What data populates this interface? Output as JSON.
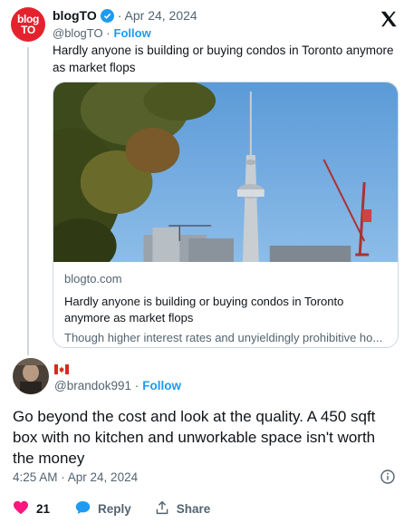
{
  "quoted": {
    "avatar_line1": "blog",
    "avatar_line2": "TO",
    "name": "blogTO",
    "date": "· Apr 24, 2024",
    "handle": "@blogTO ·",
    "follow": "Follow",
    "text": "Hardly anyone is building or buying condos in Toronto anymore as market flops",
    "card": {
      "domain": "blogto.com",
      "title": "Hardly anyone is building or buying condos in Toronto anymore as market flops",
      "description": "Though higher interest rates and unyieldingly prohibitive ho..."
    }
  },
  "tweet": {
    "handle": "@brandok991 ·",
    "follow": "Follow",
    "text": "Go beyond the cost and look at the quality. A 450 sqft box with no kitchen and unworkable space isn't worth the money",
    "timestamp": "4:25 AM · Apr 24, 2024",
    "likes": "21",
    "reply_label": "Reply",
    "share_label": "Share"
  },
  "colors": {
    "accent": "#1d9bf0",
    "like": "#f91880",
    "brand_red": "#e4222d"
  },
  "icons": [
    "x-logo-icon",
    "verified-badge-icon",
    "canada-flag-icon",
    "info-icon",
    "heart-icon",
    "reply-icon",
    "share-icon"
  ]
}
